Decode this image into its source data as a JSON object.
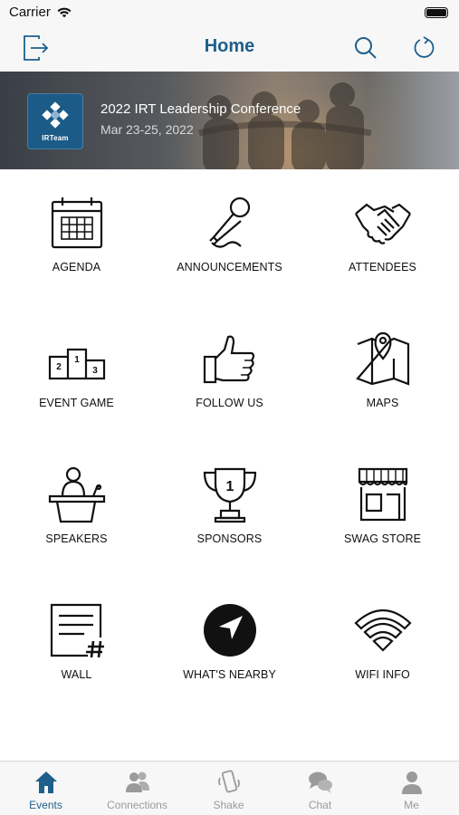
{
  "status_bar": {
    "carrier": "Carrier"
  },
  "nav": {
    "title": "Home"
  },
  "banner": {
    "logo_text": "IRTeam",
    "title": "2022 IRT Leadership Conference",
    "dates": "Mar 23-25, 2022"
  },
  "grid": {
    "tiles": [
      {
        "label": "AGENDA",
        "icon": "calendar-icon"
      },
      {
        "label": "ANNOUNCEMENTS",
        "icon": "microphone-icon"
      },
      {
        "label": "ATTENDEES",
        "icon": "handshake-icon"
      },
      {
        "label": "EVENT GAME",
        "icon": "podium-icon"
      },
      {
        "label": "FOLLOW US",
        "icon": "thumbs-up-icon"
      },
      {
        "label": "MAPS",
        "icon": "map-pin-icon"
      },
      {
        "label": "SPEAKERS",
        "icon": "speaker-lectern-icon"
      },
      {
        "label": "SPONSORS",
        "icon": "trophy-icon"
      },
      {
        "label": "SWAG STORE",
        "icon": "storefront-icon"
      },
      {
        "label": "WALL",
        "icon": "wall-post-icon"
      },
      {
        "label": "WHAT'S NEARBY",
        "icon": "navigation-arrow-icon"
      },
      {
        "label": "WIFI INFO",
        "icon": "wifi-icon"
      }
    ]
  },
  "tab_bar": {
    "tabs": [
      {
        "label": "Events",
        "icon": "house-icon",
        "active": true
      },
      {
        "label": "Connections",
        "icon": "people-icon",
        "active": false
      },
      {
        "label": "Shake",
        "icon": "phone-shake-icon",
        "active": false
      },
      {
        "label": "Chat",
        "icon": "chat-bubbles-icon",
        "active": false
      },
      {
        "label": "Me",
        "icon": "person-icon",
        "active": false
      }
    ]
  },
  "colors": {
    "accent": "#1f5f8b",
    "inactive_tab": "#9a9a9a",
    "bar_bg": "#f7f7f7"
  }
}
